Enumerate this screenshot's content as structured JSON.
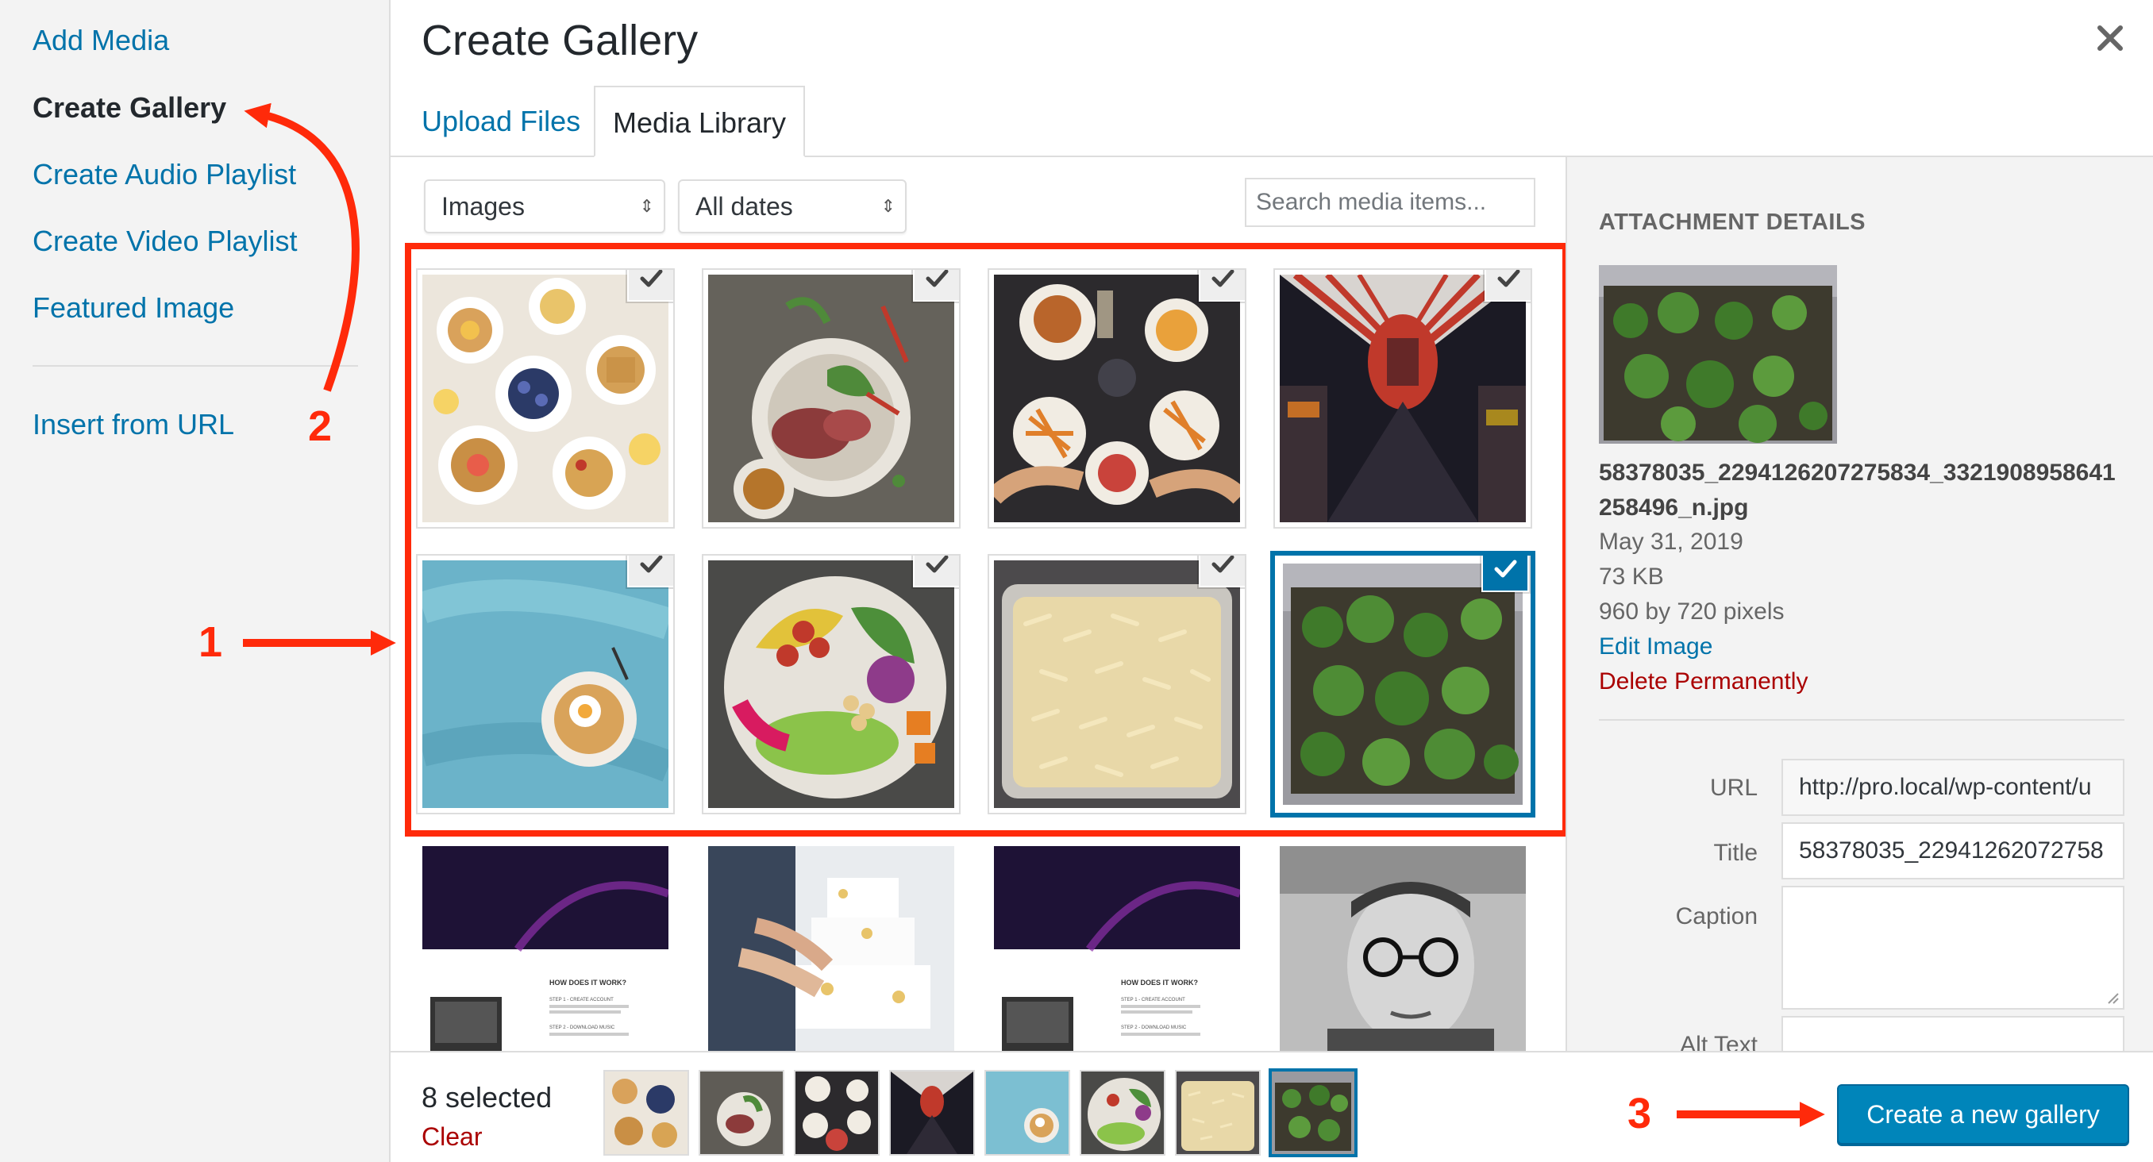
{
  "menu": {
    "items": [
      {
        "label": "Add Media",
        "active": false
      },
      {
        "label": "Create Gallery",
        "active": true
      },
      {
        "label": "Create Audio Playlist",
        "active": false
      },
      {
        "label": "Create Video Playlist",
        "active": false
      },
      {
        "label": "Featured Image",
        "active": false
      }
    ],
    "insert_from_url": "Insert from URL"
  },
  "header": {
    "title": "Create Gallery",
    "tabs": [
      {
        "label": "Upload Files",
        "active": false
      },
      {
        "label": "Media Library",
        "active": true
      }
    ]
  },
  "toolbar": {
    "type_filter": "Images",
    "date_filter": "All dates",
    "search_placeholder": "Search media items..."
  },
  "grid": {
    "items": [
      {
        "name": "brunch-spread",
        "selected": true,
        "active": false
      },
      {
        "name": "steak-salad",
        "selected": true,
        "active": false
      },
      {
        "name": "burgers-table",
        "selected": true,
        "active": false
      },
      {
        "name": "lantern-street",
        "selected": true,
        "active": false
      },
      {
        "name": "breakfast-plate-blue",
        "selected": true,
        "active": false
      },
      {
        "name": "salad-bowl",
        "selected": true,
        "active": false
      },
      {
        "name": "pasta-tray",
        "selected": true,
        "active": false
      },
      {
        "name": "broccoli-tray",
        "selected": true,
        "active": true
      },
      {
        "name": "website-screenshot",
        "selected": false,
        "active": false
      },
      {
        "name": "wedding-cake",
        "selected": false,
        "active": false
      },
      {
        "name": "website-screenshot-2",
        "selected": false,
        "active": false
      },
      {
        "name": "portrait-man",
        "selected": false,
        "active": false
      }
    ],
    "screenshot_text": {
      "heading": "HOW DOES IT WORK?",
      "step1": "STEP 1 - CREATE ACCOUNT",
      "step2": "STEP 2 - DOWNLOAD MUSIC"
    }
  },
  "attachment": {
    "heading": "ATTACHMENT DETAILS",
    "filename": "58378035_2294126207275834_3321908958641258496_n.jpg",
    "date": "May 31, 2019",
    "size": "73 KB",
    "dimensions": "960 by 720 pixels",
    "edit_link": "Edit Image",
    "delete_link": "Delete Permanently",
    "fields": {
      "url_label": "URL",
      "url_value": "http://pro.local/wp-content/u",
      "title_label": "Title",
      "title_value": "58378035_22941262072758",
      "caption_label": "Caption",
      "alt_label": "Alt Text"
    }
  },
  "bottom": {
    "selected_count": "8 selected",
    "clear": "Clear",
    "primary_button": "Create a new gallery"
  },
  "annotations": {
    "one": "1",
    "two": "2",
    "three": "3",
    "color": "#ff2a0a"
  },
  "colors": {
    "link": "#0073aa",
    "primary": "#0085ba",
    "danger": "#a00"
  }
}
